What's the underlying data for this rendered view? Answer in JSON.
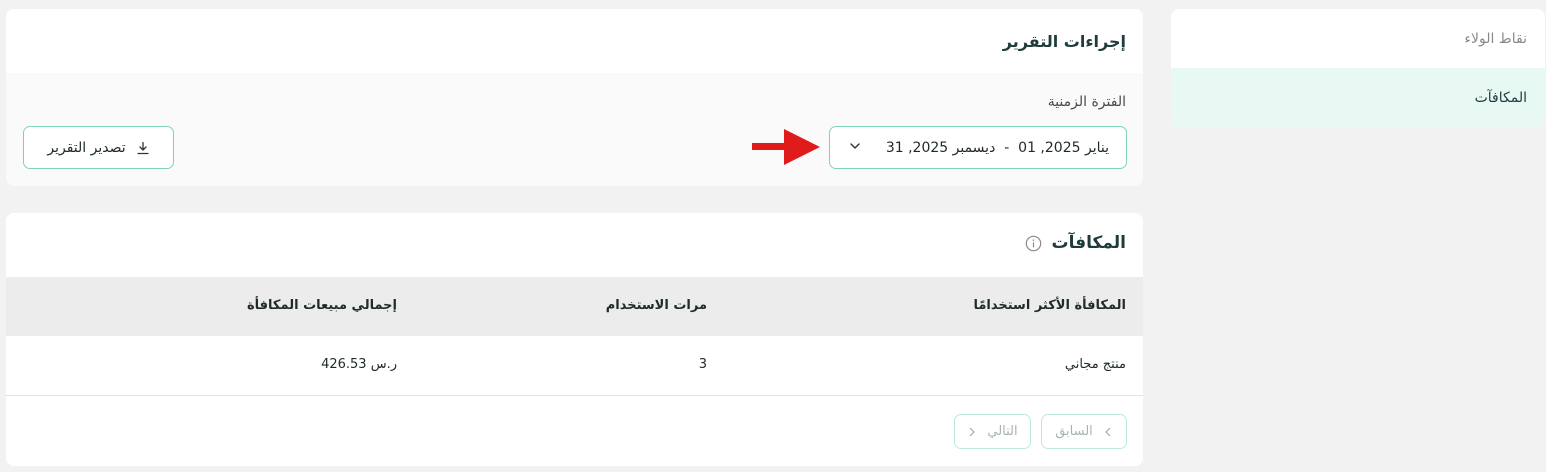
{
  "sidebar": {
    "items": [
      {
        "label": "نقاط الولاء",
        "active": false
      },
      {
        "label": "المكافآت",
        "active": true
      }
    ]
  },
  "report_actions": {
    "title": "إجراءات التقرير",
    "period_label": "الفترة الزمنية",
    "date_range": "يناير 2025, 01  -  ديسمبر 2025, 31",
    "export_label": "تصدير التقرير"
  },
  "rewards": {
    "title": "المكافآت",
    "columns": [
      "المكافأة الأكثر استخدامًا",
      "مرات الاستخدام",
      "إجمالي مبيعات المكافأة"
    ],
    "rows": [
      {
        "reward": "منتج مجاني",
        "uses": "3",
        "sales": "426.53 ر.س"
      }
    ],
    "prev_label": "السابق",
    "next_label": "التالي"
  },
  "colors": {
    "accent_border": "#7fd4b8",
    "active_bg": "#e8f8f3",
    "annotation_arrow": "#e01b1b"
  },
  "icons": [
    "download-icon",
    "chevron-down-icon",
    "info-icon",
    "chevron-left-icon",
    "chevron-right-icon",
    "red-arrow-annotation"
  ]
}
